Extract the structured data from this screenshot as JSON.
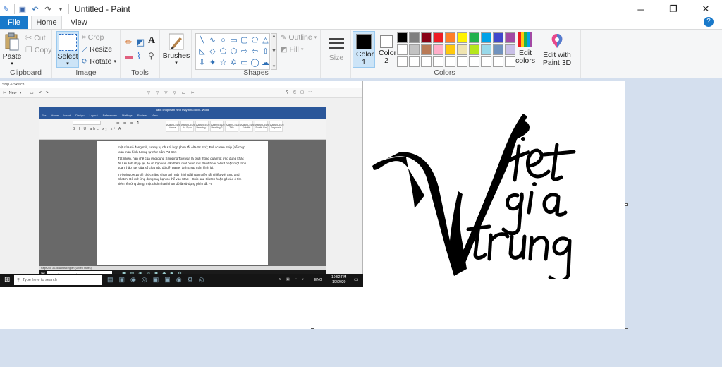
{
  "window": {
    "title": "Untitled - Paint",
    "minimize": "─",
    "maximize": "❐",
    "close": "✕"
  },
  "tabs": [
    {
      "label": "File"
    },
    {
      "label": "Home"
    },
    {
      "label": "View"
    }
  ],
  "help": "?",
  "clipboard": {
    "paste": "Paste",
    "cut": "Cut",
    "copy": "Copy",
    "group": "Clipboard"
  },
  "image": {
    "select": "Select",
    "crop": "Crop",
    "resize": "Resize",
    "rotate": "Rotate",
    "group": "Image"
  },
  "tools": {
    "group": "Tools"
  },
  "brushes": {
    "label": "Brushes"
  },
  "shapes": {
    "outline": "Outline",
    "fill": "Fill",
    "group": "Shapes"
  },
  "size": {
    "label": "Size"
  },
  "colors": {
    "color1": "Color 1",
    "color2": "Color 2",
    "edit": "Edit colors",
    "paint3d": "Edit with Paint 3D",
    "group": "Colors",
    "color1_value": "#000000",
    "color2_value": "#ffffff",
    "palette_row1": [
      "#000000",
      "#7f7f7f",
      "#880015",
      "#ed1c24",
      "#ff7f27",
      "#fff200",
      "#22b14c",
      "#00a2e8",
      "#3f48cc",
      "#a349a4"
    ],
    "palette_row2": [
      "#ffffff",
      "#c3c3c3",
      "#b97a57",
      "#ffaec9",
      "#ffc90e",
      "#efe4b0",
      "#b5e61d",
      "#99d9ea",
      "#7092be",
      "#c8bfe7"
    ],
    "palette_row3_count": 10
  },
  "canvas": {
    "snip": {
      "title": "Snip & Sketch",
      "new": "New",
      "taskbar_search": "Type here to search",
      "inner_search": "Type here to search",
      "clock_time": "10:52 PM",
      "clock_date": "1/2/2020",
      "lang": "ENG",
      "word_title": "cách chụp màn hình máy tính.docx - Word",
      "word_tabs": [
        "File",
        "Home",
        "Insert",
        "Design",
        "Layout",
        "References",
        "Mailings",
        "Review",
        "View"
      ],
      "word_styles": [
        "Normal",
        "No Spac",
        "Heading 1",
        "Heading 2",
        "Title",
        "Subtitle",
        "Subtle Em",
        "Emphasis"
      ],
      "para1": "một cửa sổ đang mở, tương tự như tổ hợp phím tắt Alt+Prt Scr); Full screen Snip (để chụp toàn màn hình tương tự như bấm Prt Scr)",
      "para2": "Tất nhiên, hạn chế của ứng dụng Snipping Tool vẫn là phải thông qua một ứng dụng khác để lưu ảnh chụp lại, do đó bạn vẫn cần thêm một bước mở Paint hoặc Word hoặc một trình soạn thảo hay cửa sổ chat nào đó để \"paste\" ảnh chụp màn hình lại.",
      "para3": "Tới Window 10 thì chức năng chụp ảnh màn hình đã hoàn thiện rất nhiều với Snip and Sketch. Để mở ứng dụng này bạn có thể vào Start – Snip and Sketch hoặc gõ vào ô tìm kiếm tên ứng dụng, một cách nhanh hơn đó là sử dụng phím tắt F9",
      "status": "Page 2 of 3    108 words    English (United States)"
    }
  }
}
